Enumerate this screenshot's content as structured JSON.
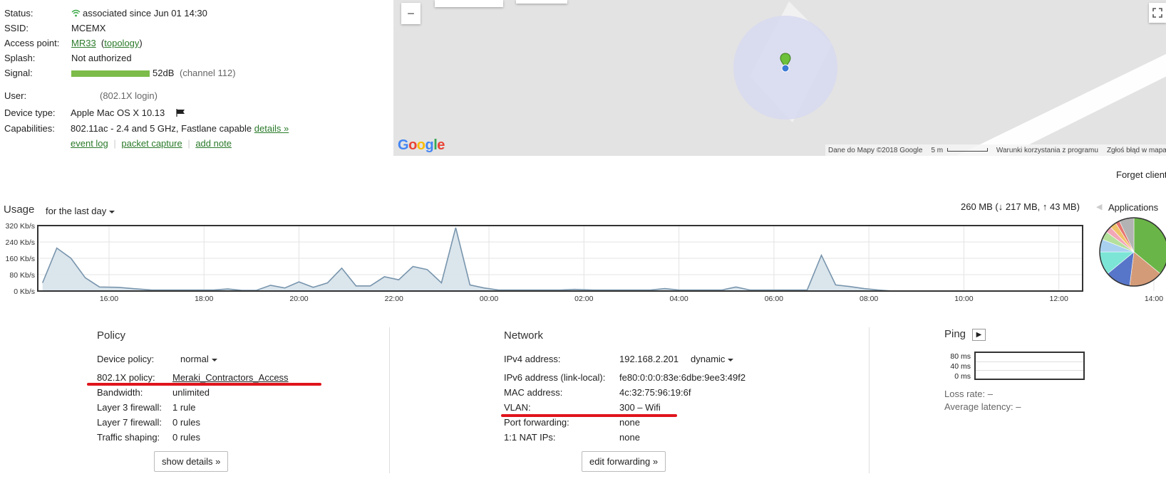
{
  "details": {
    "status_label": "Status:",
    "status_value": "associated since Jun 01 14:30",
    "ssid_label": "SSID:",
    "ssid_value": "MCEMX",
    "ap_label": "Access point:",
    "ap_value": "MR33",
    "ap_topology": "topology",
    "splash_label": "Splash:",
    "splash_value": "Not authorized",
    "signal_label": "Signal:",
    "signal_value": "52dB",
    "signal_channel": "(channel 112)",
    "signal_level_pct": 100,
    "user_label": "User:",
    "user_value": "(802.1X login)",
    "device_label": "Device type:",
    "device_value": "Apple Mac OS X 10.13",
    "cap_label": "Capabilities:",
    "cap_value": "802.11ac - 2.4 and 5 GHz, Fastlane capable",
    "cap_details": "details »",
    "links": [
      "event log",
      "packet capture",
      "add note"
    ]
  },
  "map": {
    "zoom_out": "−",
    "attribution": "Dane do Mapy ©2018 Google",
    "scale": "5 m",
    "terms": "Warunki korzystania z programu",
    "report": "Zgłoś błąd w mapach",
    "google_logo": "Google"
  },
  "forget_client": "Forget client",
  "usage": {
    "title": "Usage",
    "range": "for the last day",
    "total": "260 MB (↓ 217 MB, ↑ 43 MB)",
    "applications": "Applications"
  },
  "chart_data": {
    "type": "area",
    "ylabels": [
      "320 Kb/s",
      "240 Kb/s",
      "160 Kb/s",
      "80 Kb/s",
      "0 Kb/s"
    ],
    "xlabels": [
      "16:00",
      "18:00",
      "20:00",
      "22:00",
      "00:00",
      "02:00",
      "04:00",
      "06:00",
      "08:00",
      "10:00",
      "12:00",
      "14:00"
    ],
    "ylim": [
      0,
      320
    ],
    "x_hours": [
      14.6,
      14.9,
      15.2,
      15.5,
      15.8,
      16.2,
      16.5,
      16.9,
      17.2,
      17.5,
      17.8,
      18.2,
      18.5,
      18.8,
      19.1,
      19.4,
      19.7,
      20.0,
      20.3,
      20.6,
      20.9,
      21.2,
      21.5,
      21.8,
      22.1,
      22.4,
      22.7,
      23.0,
      23.3,
      23.6,
      23.9,
      24.2,
      24.5,
      24.8,
      25.2,
      25.5,
      25.8,
      26.2,
      26.5,
      26.8,
      27.1,
      27.4,
      27.7,
      28.0,
      28.3,
      28.6,
      28.9,
      29.2,
      29.5,
      29.8,
      30.1,
      30.4,
      30.7,
      31.0,
      31.3,
      31.6,
      31.9,
      32.2,
      32.5,
      32.8,
      33.1,
      33.4,
      33.7,
      34.0
    ],
    "values": [
      40,
      210,
      160,
      65,
      20,
      18,
      12,
      5,
      5,
      5,
      5,
      5,
      10,
      3,
      3,
      28,
      15,
      45,
      18,
      40,
      112,
      25,
      25,
      70,
      55,
      120,
      105,
      40,
      310,
      30,
      15,
      5,
      5,
      5,
      5,
      5,
      8,
      5,
      5,
      5,
      5,
      5,
      12,
      5,
      5,
      5,
      5,
      20,
      5,
      5,
      5,
      5,
      5,
      175,
      30,
      22,
      12,
      5,
      0,
      0,
      0,
      0,
      0,
      0
    ],
    "ring_area_color": "#d7e2ea",
    "line_color": "#7895ad"
  },
  "pie": {
    "slices": [
      {
        "value": 36,
        "color": "#6ab547"
      },
      {
        "value": 16,
        "color": "#d49b78"
      },
      {
        "value": 12,
        "color": "#5876c9"
      },
      {
        "value": 11,
        "color": "#7ce5d6"
      },
      {
        "value": 6,
        "color": "#a9d1ef"
      },
      {
        "value": 4,
        "color": "#b4e09c"
      },
      {
        "value": 3,
        "color": "#f2a7b7"
      },
      {
        "value": 3,
        "color": "#f0c36a"
      },
      {
        "value": 2,
        "color": "#e7756f"
      },
      {
        "value": 7,
        "color": "#b3b3b3"
      }
    ]
  },
  "policy": {
    "title": "Policy",
    "device_policy_label": "Device policy:",
    "device_policy_value": "normal",
    "dot1x_label": "802.1X policy:",
    "dot1x_value": "Meraki_Contractors_Access",
    "bandwidth_label": "Bandwidth:",
    "bandwidth_value": "unlimited",
    "l3_label": "Layer 3 firewall:",
    "l3_value": "1 rule",
    "l7_label": "Layer 7 firewall:",
    "l7_value": "0 rules",
    "shaping_label": "Traffic shaping:",
    "shaping_value": "0 rules",
    "show_details": "show details »"
  },
  "network": {
    "title": "Network",
    "ipv4_label": "IPv4 address:",
    "ipv4_value": "192.168.2.201",
    "ipv4_mode": "dynamic",
    "ipv6_label": "IPv6 address (link-local):",
    "ipv6_value": "fe80:0:0:0:83e:6dbe:9ee3:49f2",
    "mac_label": "MAC address:",
    "mac_value": "4c:32:75:96:19:6f",
    "vlan_label": "VLAN:",
    "vlan_value": "300 – Wifi",
    "pf_label": "Port forwarding:",
    "pf_value": "none",
    "nat_label": "1:1 NAT IPs:",
    "nat_value": "none",
    "edit_forwarding": "edit forwarding »"
  },
  "ping": {
    "title": "Ping",
    "play": "▶",
    "ylabels": [
      "80 ms",
      "40 ms",
      "0 ms"
    ],
    "loss_label": "Loss rate:",
    "loss_value": "–",
    "latency_label": "Average latency:",
    "latency_value": "–"
  }
}
